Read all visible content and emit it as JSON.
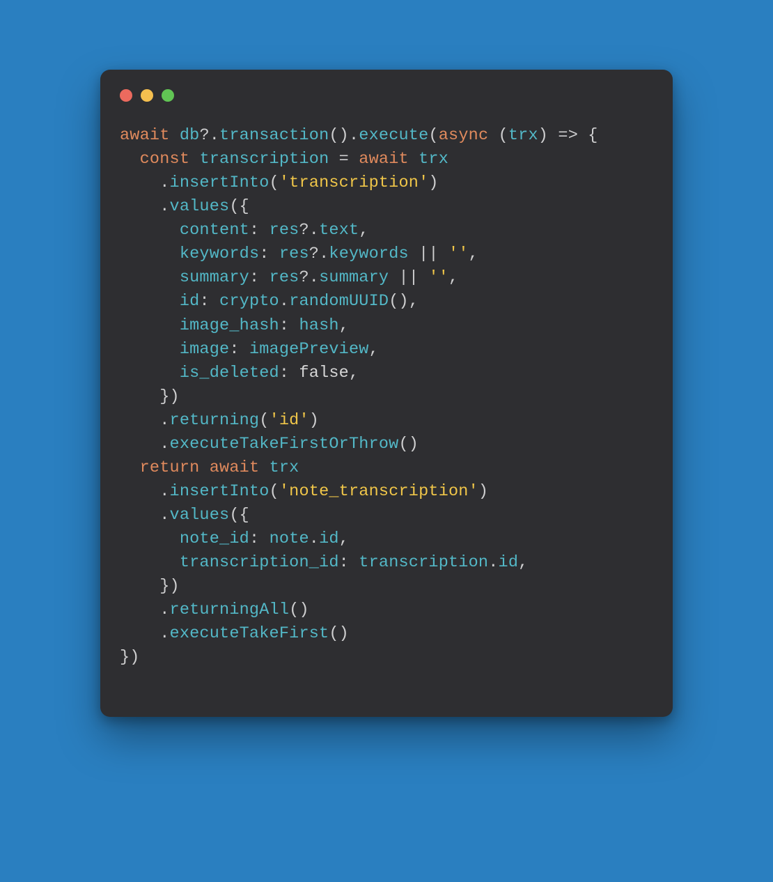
{
  "colors": {
    "background": "#2a7fc0",
    "window": "#2e2e31",
    "traffic_red": "#ec6a5e",
    "traffic_yellow": "#f5bf4f",
    "traffic_green": "#61c554"
  },
  "titlebar": {
    "close_name": "close",
    "minimize_name": "minimize",
    "zoom_name": "zoom"
  },
  "code": {
    "lines": [
      [
        {
          "cls": "tok-keyword",
          "t": "await"
        },
        {
          "cls": "tok-punct",
          "t": " "
        },
        {
          "cls": "tok-var",
          "t": "db"
        },
        {
          "cls": "tok-punct",
          "t": "?."
        },
        {
          "cls": "tok-method",
          "t": "transaction"
        },
        {
          "cls": "tok-punct",
          "t": "()."
        },
        {
          "cls": "tok-method",
          "t": "execute"
        },
        {
          "cls": "tok-punct",
          "t": "("
        },
        {
          "cls": "tok-keyword",
          "t": "async"
        },
        {
          "cls": "tok-punct",
          "t": " ("
        },
        {
          "cls": "tok-var",
          "t": "trx"
        },
        {
          "cls": "tok-punct",
          "t": ") => {"
        }
      ],
      [
        {
          "cls": "tok-punct",
          "t": "  "
        },
        {
          "cls": "tok-keyword",
          "t": "const"
        },
        {
          "cls": "tok-punct",
          "t": " "
        },
        {
          "cls": "tok-var",
          "t": "transcription"
        },
        {
          "cls": "tok-punct",
          "t": " = "
        },
        {
          "cls": "tok-keyword",
          "t": "await"
        },
        {
          "cls": "tok-punct",
          "t": " "
        },
        {
          "cls": "tok-var",
          "t": "trx"
        }
      ],
      [
        {
          "cls": "tok-punct",
          "t": "    ."
        },
        {
          "cls": "tok-method",
          "t": "insertInto"
        },
        {
          "cls": "tok-punct",
          "t": "("
        },
        {
          "cls": "tok-string",
          "t": "'transcription'"
        },
        {
          "cls": "tok-punct",
          "t": ")"
        }
      ],
      [
        {
          "cls": "tok-punct",
          "t": "    ."
        },
        {
          "cls": "tok-method",
          "t": "values"
        },
        {
          "cls": "tok-punct",
          "t": "({"
        }
      ],
      [
        {
          "cls": "tok-punct",
          "t": "      "
        },
        {
          "cls": "tok-prop",
          "t": "content"
        },
        {
          "cls": "tok-punct",
          "t": ": "
        },
        {
          "cls": "tok-var",
          "t": "res"
        },
        {
          "cls": "tok-punct",
          "t": "?."
        },
        {
          "cls": "tok-method",
          "t": "text"
        },
        {
          "cls": "tok-punct",
          "t": ","
        }
      ],
      [
        {
          "cls": "tok-punct",
          "t": "      "
        },
        {
          "cls": "tok-prop",
          "t": "keywords"
        },
        {
          "cls": "tok-punct",
          "t": ": "
        },
        {
          "cls": "tok-var",
          "t": "res"
        },
        {
          "cls": "tok-punct",
          "t": "?."
        },
        {
          "cls": "tok-method",
          "t": "keywords"
        },
        {
          "cls": "tok-punct",
          "t": " || "
        },
        {
          "cls": "tok-string",
          "t": "''"
        },
        {
          "cls": "tok-punct",
          "t": ","
        }
      ],
      [
        {
          "cls": "tok-punct",
          "t": "      "
        },
        {
          "cls": "tok-prop",
          "t": "summary"
        },
        {
          "cls": "tok-punct",
          "t": ": "
        },
        {
          "cls": "tok-var",
          "t": "res"
        },
        {
          "cls": "tok-punct",
          "t": "?."
        },
        {
          "cls": "tok-method",
          "t": "summary"
        },
        {
          "cls": "tok-punct",
          "t": " || "
        },
        {
          "cls": "tok-string",
          "t": "''"
        },
        {
          "cls": "tok-punct",
          "t": ","
        }
      ],
      [
        {
          "cls": "tok-punct",
          "t": "      "
        },
        {
          "cls": "tok-prop",
          "t": "id"
        },
        {
          "cls": "tok-punct",
          "t": ": "
        },
        {
          "cls": "tok-var",
          "t": "crypto"
        },
        {
          "cls": "tok-punct",
          "t": "."
        },
        {
          "cls": "tok-method",
          "t": "randomUUID"
        },
        {
          "cls": "tok-punct",
          "t": "(),"
        }
      ],
      [
        {
          "cls": "tok-punct",
          "t": "      "
        },
        {
          "cls": "tok-prop",
          "t": "image_hash"
        },
        {
          "cls": "tok-punct",
          "t": ": "
        },
        {
          "cls": "tok-var",
          "t": "hash"
        },
        {
          "cls": "tok-punct",
          "t": ","
        }
      ],
      [
        {
          "cls": "tok-punct",
          "t": "      "
        },
        {
          "cls": "tok-prop",
          "t": "image"
        },
        {
          "cls": "tok-punct",
          "t": ": "
        },
        {
          "cls": "tok-var",
          "t": "imagePreview"
        },
        {
          "cls": "tok-punct",
          "t": ","
        }
      ],
      [
        {
          "cls": "tok-punct",
          "t": "      "
        },
        {
          "cls": "tok-prop",
          "t": "is_deleted"
        },
        {
          "cls": "tok-punct",
          "t": ": "
        },
        {
          "cls": "tok-bool",
          "t": "false"
        },
        {
          "cls": "tok-punct",
          "t": ","
        }
      ],
      [
        {
          "cls": "tok-punct",
          "t": "    })"
        }
      ],
      [
        {
          "cls": "tok-punct",
          "t": "    ."
        },
        {
          "cls": "tok-method",
          "t": "returning"
        },
        {
          "cls": "tok-punct",
          "t": "("
        },
        {
          "cls": "tok-string",
          "t": "'id'"
        },
        {
          "cls": "tok-punct",
          "t": ")"
        }
      ],
      [
        {
          "cls": "tok-punct",
          "t": "    ."
        },
        {
          "cls": "tok-method",
          "t": "executeTakeFirstOrThrow"
        },
        {
          "cls": "tok-punct",
          "t": "()"
        }
      ],
      [
        {
          "cls": "tok-punct",
          "t": "  "
        },
        {
          "cls": "tok-keyword",
          "t": "return"
        },
        {
          "cls": "tok-punct",
          "t": " "
        },
        {
          "cls": "tok-keyword",
          "t": "await"
        },
        {
          "cls": "tok-punct",
          "t": " "
        },
        {
          "cls": "tok-var",
          "t": "trx"
        }
      ],
      [
        {
          "cls": "tok-punct",
          "t": "    ."
        },
        {
          "cls": "tok-method",
          "t": "insertInto"
        },
        {
          "cls": "tok-punct",
          "t": "("
        },
        {
          "cls": "tok-string",
          "t": "'note_transcription'"
        },
        {
          "cls": "tok-punct",
          "t": ")"
        }
      ],
      [
        {
          "cls": "tok-punct",
          "t": "    ."
        },
        {
          "cls": "tok-method",
          "t": "values"
        },
        {
          "cls": "tok-punct",
          "t": "({"
        }
      ],
      [
        {
          "cls": "tok-punct",
          "t": "      "
        },
        {
          "cls": "tok-prop",
          "t": "note_id"
        },
        {
          "cls": "tok-punct",
          "t": ": "
        },
        {
          "cls": "tok-var",
          "t": "note"
        },
        {
          "cls": "tok-punct",
          "t": "."
        },
        {
          "cls": "tok-method",
          "t": "id"
        },
        {
          "cls": "tok-punct",
          "t": ","
        }
      ],
      [
        {
          "cls": "tok-punct",
          "t": "      "
        },
        {
          "cls": "tok-prop",
          "t": "transcription_id"
        },
        {
          "cls": "tok-punct",
          "t": ": "
        },
        {
          "cls": "tok-var",
          "t": "transcription"
        },
        {
          "cls": "tok-punct",
          "t": "."
        },
        {
          "cls": "tok-method",
          "t": "id"
        },
        {
          "cls": "tok-punct",
          "t": ","
        }
      ],
      [
        {
          "cls": "tok-punct",
          "t": "    })"
        }
      ],
      [
        {
          "cls": "tok-punct",
          "t": "    ."
        },
        {
          "cls": "tok-method",
          "t": "returningAll"
        },
        {
          "cls": "tok-punct",
          "t": "()"
        }
      ],
      [
        {
          "cls": "tok-punct",
          "t": "    ."
        },
        {
          "cls": "tok-method",
          "t": "executeTakeFirst"
        },
        {
          "cls": "tok-punct",
          "t": "()"
        }
      ],
      [
        {
          "cls": "tok-punct",
          "t": "})"
        }
      ]
    ]
  }
}
